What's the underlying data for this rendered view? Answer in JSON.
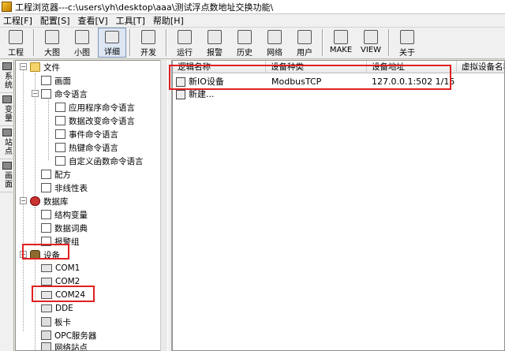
{
  "window": {
    "title": "工程浏览器---c:\\users\\yh\\desktop\\aaa\\测试浮点数地址交换功能\\"
  },
  "menu": [
    "工程[F]",
    "配置[S]",
    "查看[V]",
    "工具[T]",
    "帮助[H]"
  ],
  "toolbar": {
    "buttons": [
      {
        "label": "工程",
        "icon": "project-icon"
      },
      {
        "label": "大图",
        "icon": "large-icons-icon"
      },
      {
        "label": "小图",
        "icon": "small-icons-icon"
      },
      {
        "label": "详细",
        "icon": "details-icon",
        "active": true
      },
      {
        "label": "开发",
        "icon": "develop-icon"
      },
      {
        "label": "运行",
        "icon": "run-icon"
      },
      {
        "label": "报警",
        "icon": "alarm-icon"
      },
      {
        "label": "历史",
        "icon": "history-icon"
      },
      {
        "label": "网络",
        "icon": "network-icon"
      },
      {
        "label": "用户",
        "icon": "user-icon"
      },
      {
        "label": "MAKE",
        "icon": "make-icon"
      },
      {
        "label": "VIEW",
        "icon": "view-icon"
      },
      {
        "label": "关于",
        "icon": "about-icon"
      }
    ]
  },
  "side_tabs": [
    "系统",
    "变量",
    "站点",
    "画面"
  ],
  "tree": {
    "file": "文件",
    "screen": "画面",
    "command_lang": "命令语言",
    "app_cmd": "应用程序命令语言",
    "data_change_cmd": "数据改变命令语言",
    "event_cmd": "事件命令语言",
    "hotkey_cmd": "热键命令语言",
    "custom_func_cmd": "自定义函数命令语言",
    "recipe": "配方",
    "nonlinear": "非线性表",
    "database": "数据库",
    "struct_var": "结构变量",
    "data_dict": "数据词典",
    "alarm_group": "报警组",
    "device": "设备",
    "com1": "COM1",
    "com2": "COM2",
    "com24": "COM24",
    "dde": "DDE",
    "board": "板卡",
    "opc": "OPC服务器",
    "net_station": "网络站点"
  },
  "list": {
    "columns": [
      "逻辑名称",
      "设备种类",
      "设备地址",
      "虚拟设备名称"
    ],
    "rows": [
      {
        "name": "新IO设备",
        "type": "ModbusTCP",
        "address": "127.0.0.1:502 1/15",
        "virtual": ""
      },
      {
        "name": "新建...",
        "type": "",
        "address": "",
        "virtual": ""
      }
    ]
  }
}
